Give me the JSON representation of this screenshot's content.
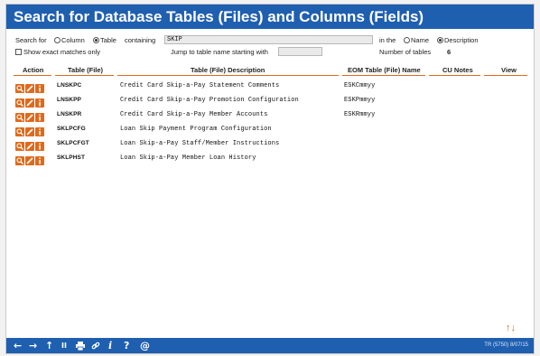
{
  "title": "Search for Database Tables (Files) and Columns (Fields)",
  "search": {
    "label": "Search for",
    "opt_column": "Column",
    "opt_table": "Table",
    "containing_label": "containing",
    "value": "SKIP",
    "in_the_label": "in the",
    "opt_name": "Name",
    "opt_description": "Description",
    "exact_label": "Show exact matches only",
    "jump_label": "Jump to table name starting with",
    "jump_value": "",
    "num_tables_label": "Number of tables",
    "num_tables_value": "6"
  },
  "columns": [
    "Action",
    "Table (File)",
    "Table (File) Description",
    "EOM Table (File) Name",
    "CU Notes",
    "View"
  ],
  "rows": [
    {
      "table": "LNSKPC",
      "desc": "Credit Card Skip-a-Pay Statement Comments",
      "eom": "ESKCmmyy"
    },
    {
      "table": "LNSKPP",
      "desc": "Credit Card Skip-a-Pay Promotion Configuration",
      "eom": "ESKPmmyy"
    },
    {
      "table": "LNSKPR",
      "desc": "Credit Card Skip-a-Pay Member Accounts",
      "eom": "ESKRmmyy"
    },
    {
      "table": "SKLPCFG",
      "desc": "Loan Skip Payment Program Configuration",
      "eom": ""
    },
    {
      "table": "SKLPCFGT",
      "desc": "Loan Skip-a-Pay Staff/Member Instructions",
      "eom": ""
    },
    {
      "table": "SKLPHST",
      "desc": "Loan Skip-a-Pay Member Loan History",
      "eom": ""
    }
  ],
  "sort_arrows": "↑↓",
  "status": "TR (5750) 8/07/15",
  "icons": {
    "back": "←",
    "forward": "→",
    "up": "↑",
    "pause": "II",
    "print": "print-icon",
    "link": "link-icon",
    "info": "i",
    "help": "?",
    "email": "@"
  },
  "colors": {
    "accent": "#1f5fb0",
    "orange": "#e06a1b"
  }
}
